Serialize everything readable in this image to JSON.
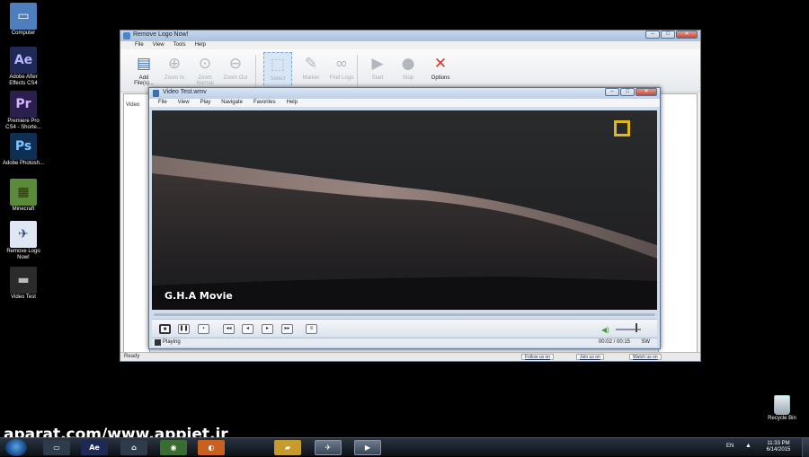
{
  "desktop_icons": [
    {
      "label": "Computer",
      "icon": "computer-icon",
      "glyph": "▭",
      "bg": "#4d7fbf",
      "fg": "#ffffff"
    },
    {
      "label": "Adobe After Effects CS4",
      "icon": "after-effects-icon",
      "glyph": "Ae",
      "bg": "#1e2a55",
      "fg": "#b9b8ff"
    },
    {
      "label": "Premiere Pro CS4 - Shorte...",
      "icon": "premiere-icon",
      "glyph": "Pr",
      "bg": "#2a1f4d",
      "fg": "#d8b4ff"
    },
    {
      "label": "Adobe Photosh...",
      "icon": "photoshop-icon",
      "glyph": "Ps",
      "bg": "#0f2f52",
      "fg": "#7fc6ff"
    },
    {
      "label": "Minecraft",
      "icon": "minecraft-icon",
      "glyph": "▦",
      "bg": "#5a8a3a",
      "fg": "#3b2a14"
    },
    {
      "label": "Remove Logo Now!",
      "icon": "remove-logo-icon",
      "glyph": "✈",
      "bg": "#dfe8f2",
      "fg": "#2a4e88"
    },
    {
      "label": "Video Test",
      "icon": "video-file-icon",
      "glyph": "▬",
      "bg": "#2b2b2b",
      "fg": "#bbbbbb"
    }
  ],
  "rln_window": {
    "title": "Remove Logo Now!",
    "menu": [
      "File",
      "View",
      "Tools",
      "Help"
    ],
    "toolbar": [
      {
        "label": "Add File(s)...",
        "icon": "add-files-icon",
        "glyph": "▤",
        "active": true
      },
      {
        "label": "Zoom In",
        "icon": "zoom-in-icon",
        "glyph": "⊕",
        "active": false
      },
      {
        "label": "Zoom Normal",
        "icon": "zoom-normal-icon",
        "glyph": "⊙",
        "active": false
      },
      {
        "label": "Zoom Out",
        "icon": "zoom-out-icon",
        "glyph": "⊖",
        "active": false
      },
      {
        "label": "Select",
        "icon": "select-icon",
        "glyph": "⬚",
        "active": false,
        "selected": true
      },
      {
        "label": "Marker",
        "icon": "marker-icon",
        "glyph": "✎",
        "active": false
      },
      {
        "label": "Find Logo",
        "icon": "find-logo-icon",
        "glyph": "∞",
        "active": false
      },
      {
        "label": "Start",
        "icon": "start-icon",
        "glyph": "▶",
        "active": false
      },
      {
        "label": "Stop",
        "icon": "stop-icon",
        "glyph": "●",
        "active": false
      },
      {
        "label": "Options",
        "icon": "options-icon",
        "glyph": "✕",
        "active": true
      }
    ],
    "left_pane_label": "Video",
    "status": "Ready",
    "status_links": [
      "Follow us on",
      "Join us on",
      "Watch us on"
    ]
  },
  "player_window": {
    "title": "Video Test.wmv",
    "menu": [
      "File",
      "View",
      "Play",
      "Navigate",
      "Favorites",
      "Help"
    ],
    "watermark_text": "G.H.A Movie",
    "controls": [
      {
        "name": "stop-button",
        "glyph": "■"
      },
      {
        "name": "pause-button",
        "glyph": "❚❚"
      },
      {
        "name": "frame-step-button",
        "glyph": "▪"
      },
      {
        "name": "skip-back-button",
        "glyph": "◂◂"
      },
      {
        "name": "rewind-button",
        "glyph": "◂"
      },
      {
        "name": "forward-button",
        "glyph": "▸"
      },
      {
        "name": "skip-forward-button",
        "glyph": "▸▸"
      },
      {
        "name": "playlist-button",
        "glyph": "≡"
      }
    ],
    "status_state": "Playing",
    "status_time": "00:02 / 00:15",
    "status_mode": "SW"
  },
  "overlay_watermark": "aparat.com/www.appjet.ir",
  "recycle_bin_label": "Recycle Bin",
  "taskbar": {
    "apps": [
      {
        "name": "taskbar-explorer-window",
        "glyph": "▭",
        "bg": "#2e3b4a",
        "active": false
      },
      {
        "name": "taskbar-after-effects",
        "glyph": "Ae",
        "bg": "#1e2a55",
        "active": false
      },
      {
        "name": "taskbar-network",
        "glyph": "⌂",
        "bg": "#2e3b4a",
        "active": false
      },
      {
        "name": "taskbar-chrome",
        "glyph": "◉",
        "bg": "#3a6c34",
        "active": false
      },
      {
        "name": "taskbar-firefox",
        "glyph": "◐",
        "bg": "#c9611e",
        "active": false
      },
      {
        "name": "taskbar-folder",
        "glyph": "▰",
        "bg": "#c79a2c",
        "active": false
      },
      {
        "name": "taskbar-remove-logo-now",
        "glyph": "✈",
        "bg": "#2e3b4a",
        "active": true
      },
      {
        "name": "taskbar-media-player",
        "glyph": "▶",
        "bg": "#2e3b4a",
        "active": true
      }
    ],
    "language": "EN",
    "time": "11:33 PM",
    "date": "6/14/2015"
  },
  "colors": {
    "accent_logo": "#e2b719",
    "desktop_bg": "#000000"
  }
}
